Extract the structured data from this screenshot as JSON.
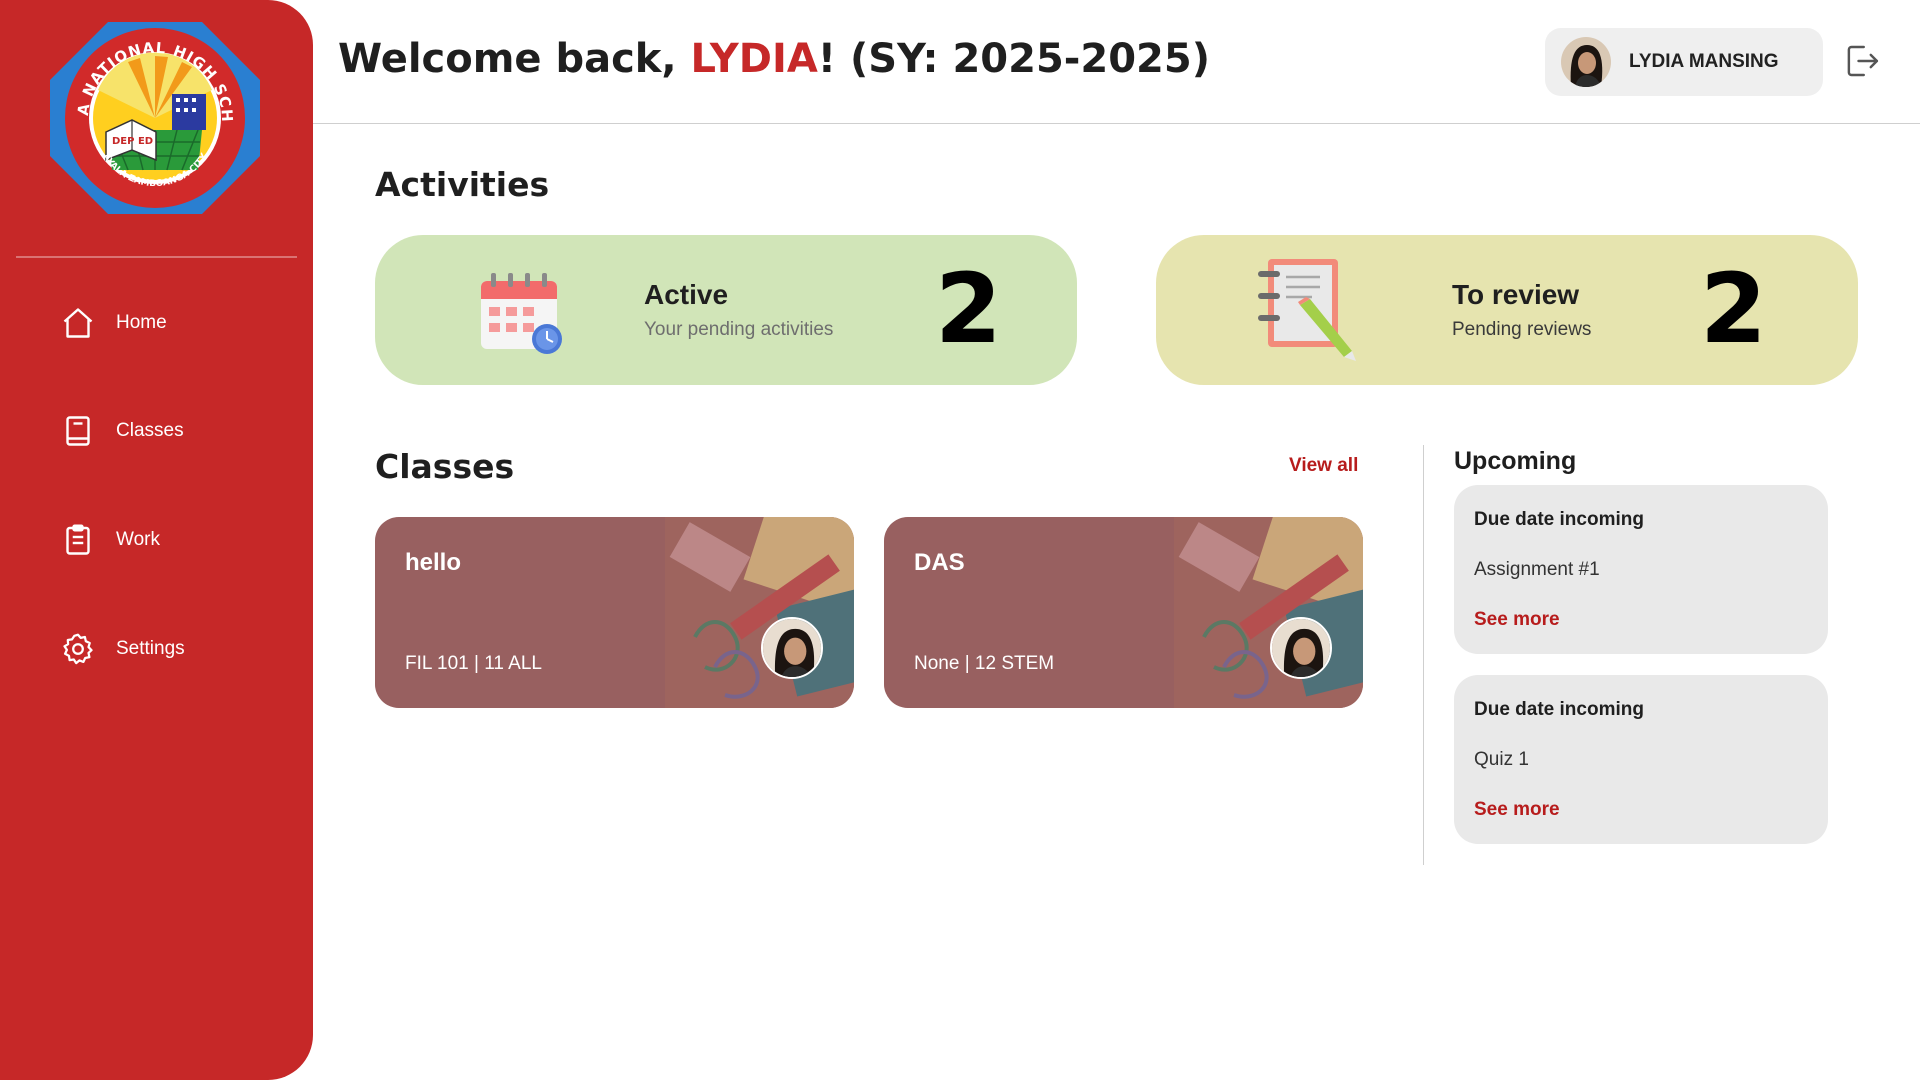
{
  "sidebar": {
    "logo": {
      "text_top": "AYALA NATIONAL HIGH SCHOOL",
      "text_bottom": "AYALA ZAMBOANGA CITY",
      "book_text": "DEP ED"
    },
    "items": [
      {
        "label": "Home",
        "icon": "home-icon"
      },
      {
        "label": "Classes",
        "icon": "book-icon"
      },
      {
        "label": "Work",
        "icon": "clipboard-icon"
      },
      {
        "label": "Settings",
        "icon": "gear-icon"
      }
    ]
  },
  "header": {
    "welcome_prefix": "Welcome back, ",
    "welcome_name": "LYDIA",
    "welcome_suffix": "! (SY: 2025-2025)",
    "user_name": "LYDIA MANSING"
  },
  "activities": {
    "title": "Activities",
    "cards": [
      {
        "title": "Active",
        "subtitle": "Your pending activities",
        "count": "2",
        "icon": "calendar-clock-icon",
        "bg": "#d1e5b8"
      },
      {
        "title": "To review",
        "subtitle": "Pending reviews",
        "count": "2",
        "icon": "notebook-pencil-icon",
        "bg": "#e6e4af"
      }
    ]
  },
  "classes": {
    "title": "Classes",
    "view_all": "View all",
    "items": [
      {
        "name": "hello",
        "details": "FIL 101 | 11 ALL"
      },
      {
        "name": "DAS",
        "details": "None | 12 STEM"
      }
    ]
  },
  "upcoming": {
    "title": "Upcoming",
    "items": [
      {
        "heading": "Due date incoming",
        "name": "Assignment #1",
        "more": "See more"
      },
      {
        "heading": "Due date incoming",
        "name": "Quiz 1",
        "more": "See more"
      }
    ]
  },
  "colors": {
    "sidebar": "#c62828",
    "accent": "#b71c1c",
    "active_card": "#d1e5b8",
    "review_card": "#e6e4af"
  }
}
